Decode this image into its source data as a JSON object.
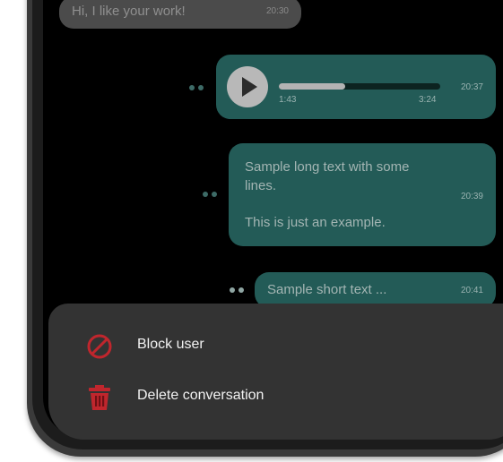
{
  "chat": {
    "incoming": {
      "text": "Hi, I like your work!",
      "time": "20:30"
    },
    "voice": {
      "elapsed": "1:43",
      "total": "3:24",
      "time": "20:37",
      "progress": 0.41
    },
    "long": {
      "line1": "Sample long text with some",
      "line2": "lines.",
      "line3": "This is just an example.",
      "time": "20:39"
    },
    "short": {
      "text": "Sample short text ...",
      "time": "20:41"
    }
  },
  "sheet": {
    "items": [
      {
        "label": "Block user",
        "icon": "block-icon"
      },
      {
        "label": "Delete conversation",
        "icon": "trash-icon"
      }
    ]
  },
  "colors": {
    "outgoing_bubble": "#235b57",
    "incoming_bubble": "#4b4b4b",
    "sheet": "#333333",
    "danger": "#c0262d"
  }
}
